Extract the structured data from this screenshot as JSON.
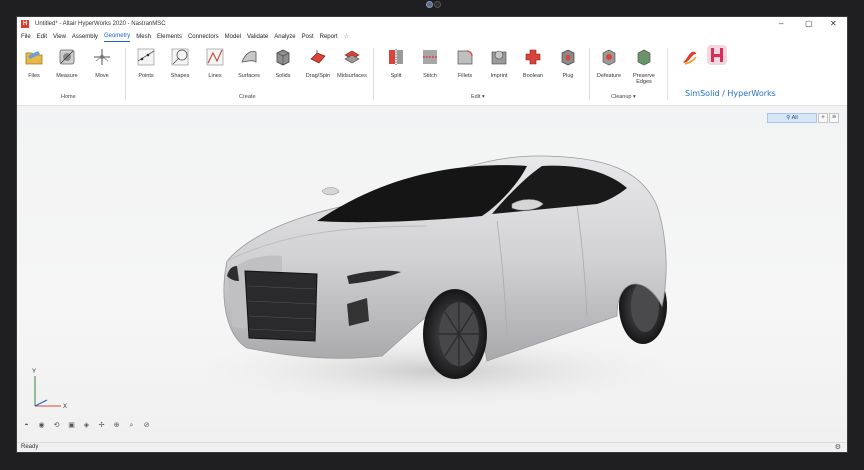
{
  "window": {
    "title": "Untitled* - Altair HyperWorks 2020 - NastranMSC",
    "app_logo": "H",
    "minimize": "–",
    "maximize": "▢",
    "close": "✕"
  },
  "menu": {
    "items": [
      "File",
      "Edit",
      "View",
      "Assembly",
      "Geometry",
      "Mesh",
      "Elements",
      "Connectors",
      "Model",
      "Validate",
      "Analyze",
      "Post",
      "Report"
    ],
    "active": "Geometry",
    "extra_icon": "☆"
  },
  "ribbon": {
    "home": {
      "label": "Home",
      "tools": [
        "Files",
        "Measure",
        "Move"
      ]
    },
    "create": {
      "label": "Create",
      "tools": [
        "Points",
        "Shapes",
        "Lines",
        "Surfaces",
        "Solids",
        "Drag/Spin",
        "Midsurfaces"
      ]
    },
    "edit": {
      "label": "Edit ▾",
      "tools": [
        "Split",
        "Stitch",
        "Fillets",
        "Imprint",
        "Boolean",
        "Plug"
      ]
    },
    "cleanup": {
      "label": "Cleanup ▾",
      "tools": [
        "Defeature",
        "Preserve\nEdges"
      ]
    },
    "brand_text": "SimSolid / HyperWorks"
  },
  "viewport": {
    "filter_label": "All",
    "plus": "+",
    "menu": "≡",
    "axis_y": "Y",
    "axis_x": "X"
  },
  "status": {
    "text": "Ready"
  },
  "colors": {
    "accent": "#1c63c9",
    "brand_red": "#e23b2e",
    "car_body": "#d4d4d6"
  }
}
